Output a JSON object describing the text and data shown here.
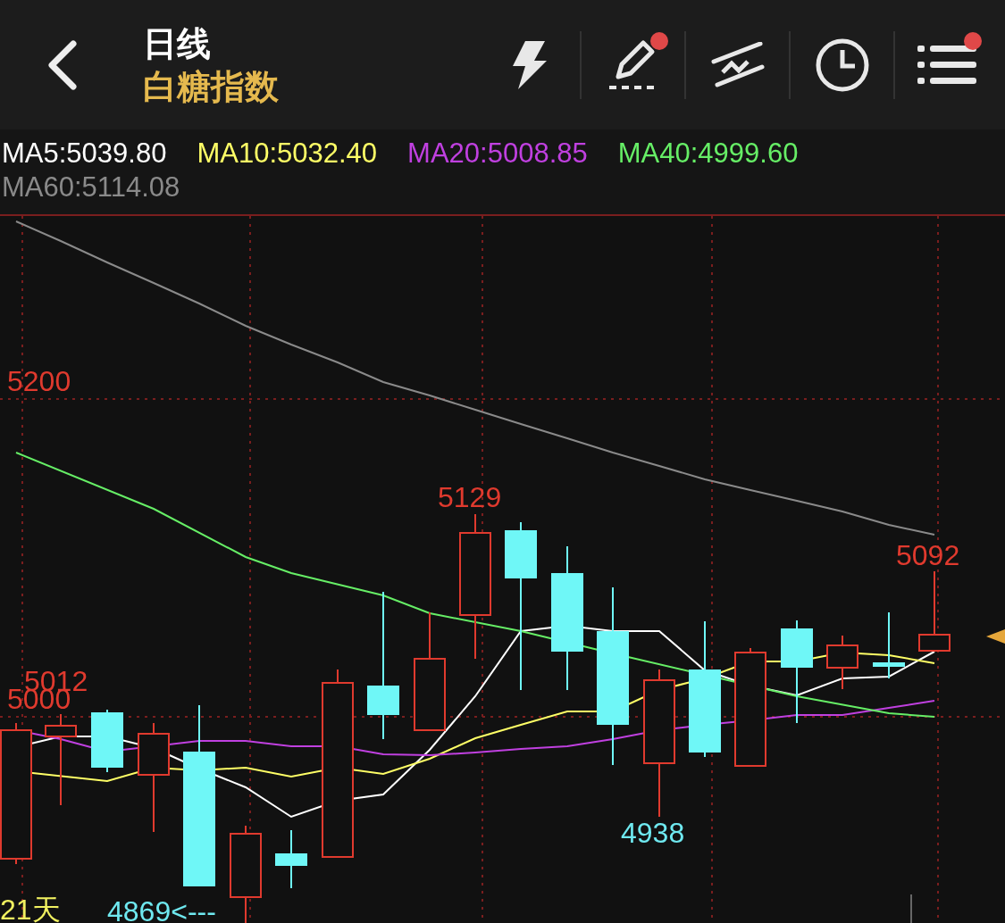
{
  "header": {
    "title": "日线",
    "subtitle": "白糖指数",
    "tools": [
      {
        "kind": "flash",
        "badge": false
      },
      {
        "kind": "draw",
        "badge": true
      },
      {
        "kind": "trend",
        "badge": false
      },
      {
        "kind": "clock",
        "badge": false
      },
      {
        "kind": "menu",
        "badge": true
      }
    ]
  },
  "legend": [
    {
      "label": "MA5:5039.80",
      "color": "#ffffff"
    },
    {
      "label": "MA10:5032.40",
      "color": "#ffff66"
    },
    {
      "label": "MA20:5008.85",
      "color": "#c040e0"
    },
    {
      "label": "MA40:4999.60",
      "color": "#66ee66"
    },
    {
      "label": "MA60:5114.08",
      "color": "#8a8a8a"
    }
  ],
  "chart": {
    "labels": [
      {
        "text": "5200",
        "kind": "price"
      },
      {
        "text": "5012",
        "kind": "price"
      },
      {
        "text": "5000",
        "kind": "price"
      },
      {
        "text": "5129",
        "kind": "price"
      },
      {
        "text": "5092",
        "kind": "price"
      },
      {
        "text": "4938",
        "kind": "low"
      },
      {
        "text": "21天",
        "kind": "period"
      },
      {
        "text": "4869<---",
        "kind": "low"
      }
    ]
  }
}
